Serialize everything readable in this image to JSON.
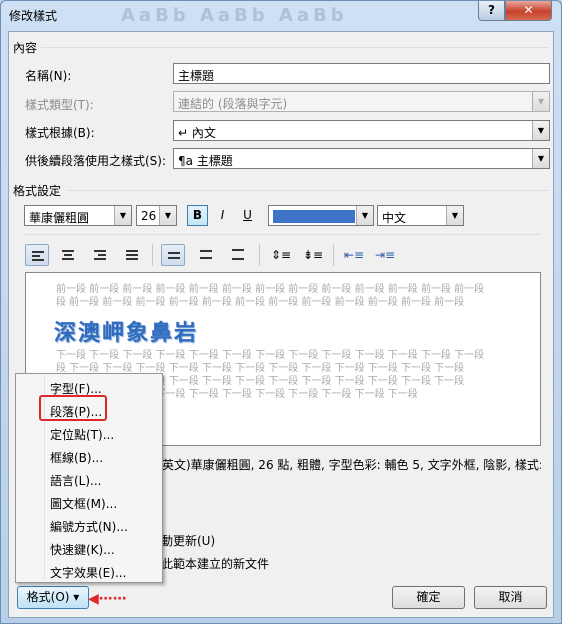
{
  "window": {
    "title": "修改樣式",
    "help_label": "?",
    "close_label": "✕",
    "bg_text": "AaBb  AaBb  AaBb"
  },
  "properties": {
    "section": "內容",
    "name_label": "名稱(N):",
    "name_value": "主標題",
    "type_label": "樣式類型(T):",
    "type_value": "連結的 (段落與字元)",
    "based_label": "樣式根據(B):",
    "based_value": "↵ 內文",
    "next_label": "供後續段落使用之樣式(S):",
    "next_value": "¶a 主標題"
  },
  "formatting": {
    "section": "格式設定",
    "font": "華康儷粗圓",
    "size": "26",
    "bold": "B",
    "italic": "I",
    "underline": "U",
    "color": "#3d74c7",
    "script": "中文"
  },
  "preview": {
    "prev_line1": "前一段 前一段 前一段 前一段 前一段 前一段 前一段 前一段 前一段 前一段 前一段 前一段 前一段",
    "prev_line2": "段 前一段 前一段 前一段 前一段 前一段 前一段 前一段 前一段 前一段 前一段 前一段 前一段",
    "sample": "深澳岬象鼻岩",
    "next_line1": "下一段 下一段 下一段 下一段 下一段 下一段 下一段 下一段 下一段 下一段 下一段 下一段 下一段",
    "next_line2": "段 下一段 下一段 下一段 下一段 下一段 下一段 下一段 下一段 下一段 下一段 下一段 下一段",
    "next_line3": "段 下一段 下一段 下一段 下一段 下一段 下一段 下一段 下一段 下一段 下一段 下一段 下一段",
    "next_line4": "下一段 下一段 下一段 下一段 下一段 下一段 下一段 下一段 下一段 下一段 下一段"
  },
  "description": "英文)華康儷粗圓, 26 點, 粗體, 字型色彩: 輔色 5, 文字外框, 陰影, 樣式: 連",
  "options": {
    "auto_update": "動更新(U)",
    "new_docs": "此範本建立的新文件"
  },
  "menu": {
    "items": [
      "字型(F)...",
      "段落(P)...",
      "定位點(T)...",
      "框線(B)...",
      "語言(L)...",
      "圖文框(M)...",
      "編號方式(N)...",
      "快速鍵(K)...",
      "文字效果(E)..."
    ]
  },
  "buttons": {
    "format": "格式(O) ▾",
    "ok": "確定",
    "cancel": "取消"
  },
  "annotation_arrow": "◀⋯⋯"
}
